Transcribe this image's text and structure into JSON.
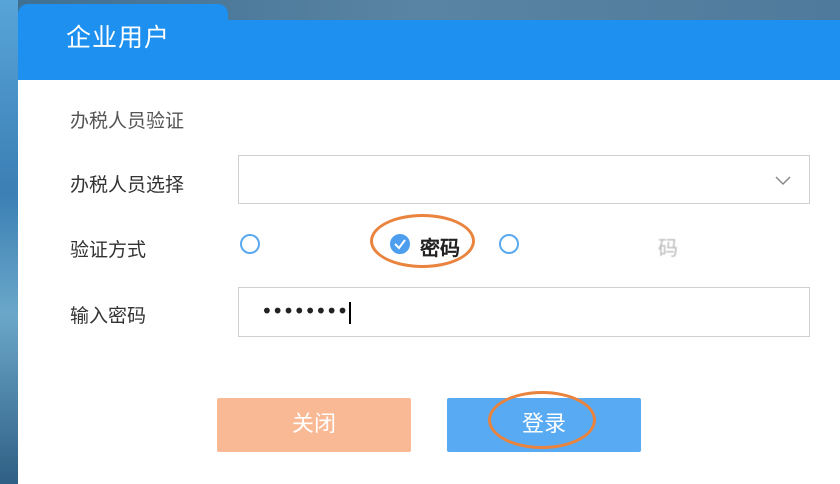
{
  "tab": {
    "title": "企业用户"
  },
  "form": {
    "section_title": "办税人员验证",
    "person_select": {
      "label": "办税人员选择",
      "value": ""
    },
    "method": {
      "label": "验证方式",
      "options": [
        {
          "label": "",
          "selected": false
        },
        {
          "label": "密码",
          "selected": true
        },
        {
          "label": "码",
          "selected": false
        }
      ]
    },
    "password": {
      "label": "输入密码",
      "value": "••••••••"
    }
  },
  "buttons": {
    "close": "关闭",
    "login": "登录"
  },
  "colors": {
    "header_blue": "#1e90f0",
    "login_blue": "#58aaf2",
    "close_peach": "#f9b995",
    "annotation_orange": "#e9833d"
  },
  "icons": [
    "chevron-down-icon",
    "radio-check-icon"
  ]
}
